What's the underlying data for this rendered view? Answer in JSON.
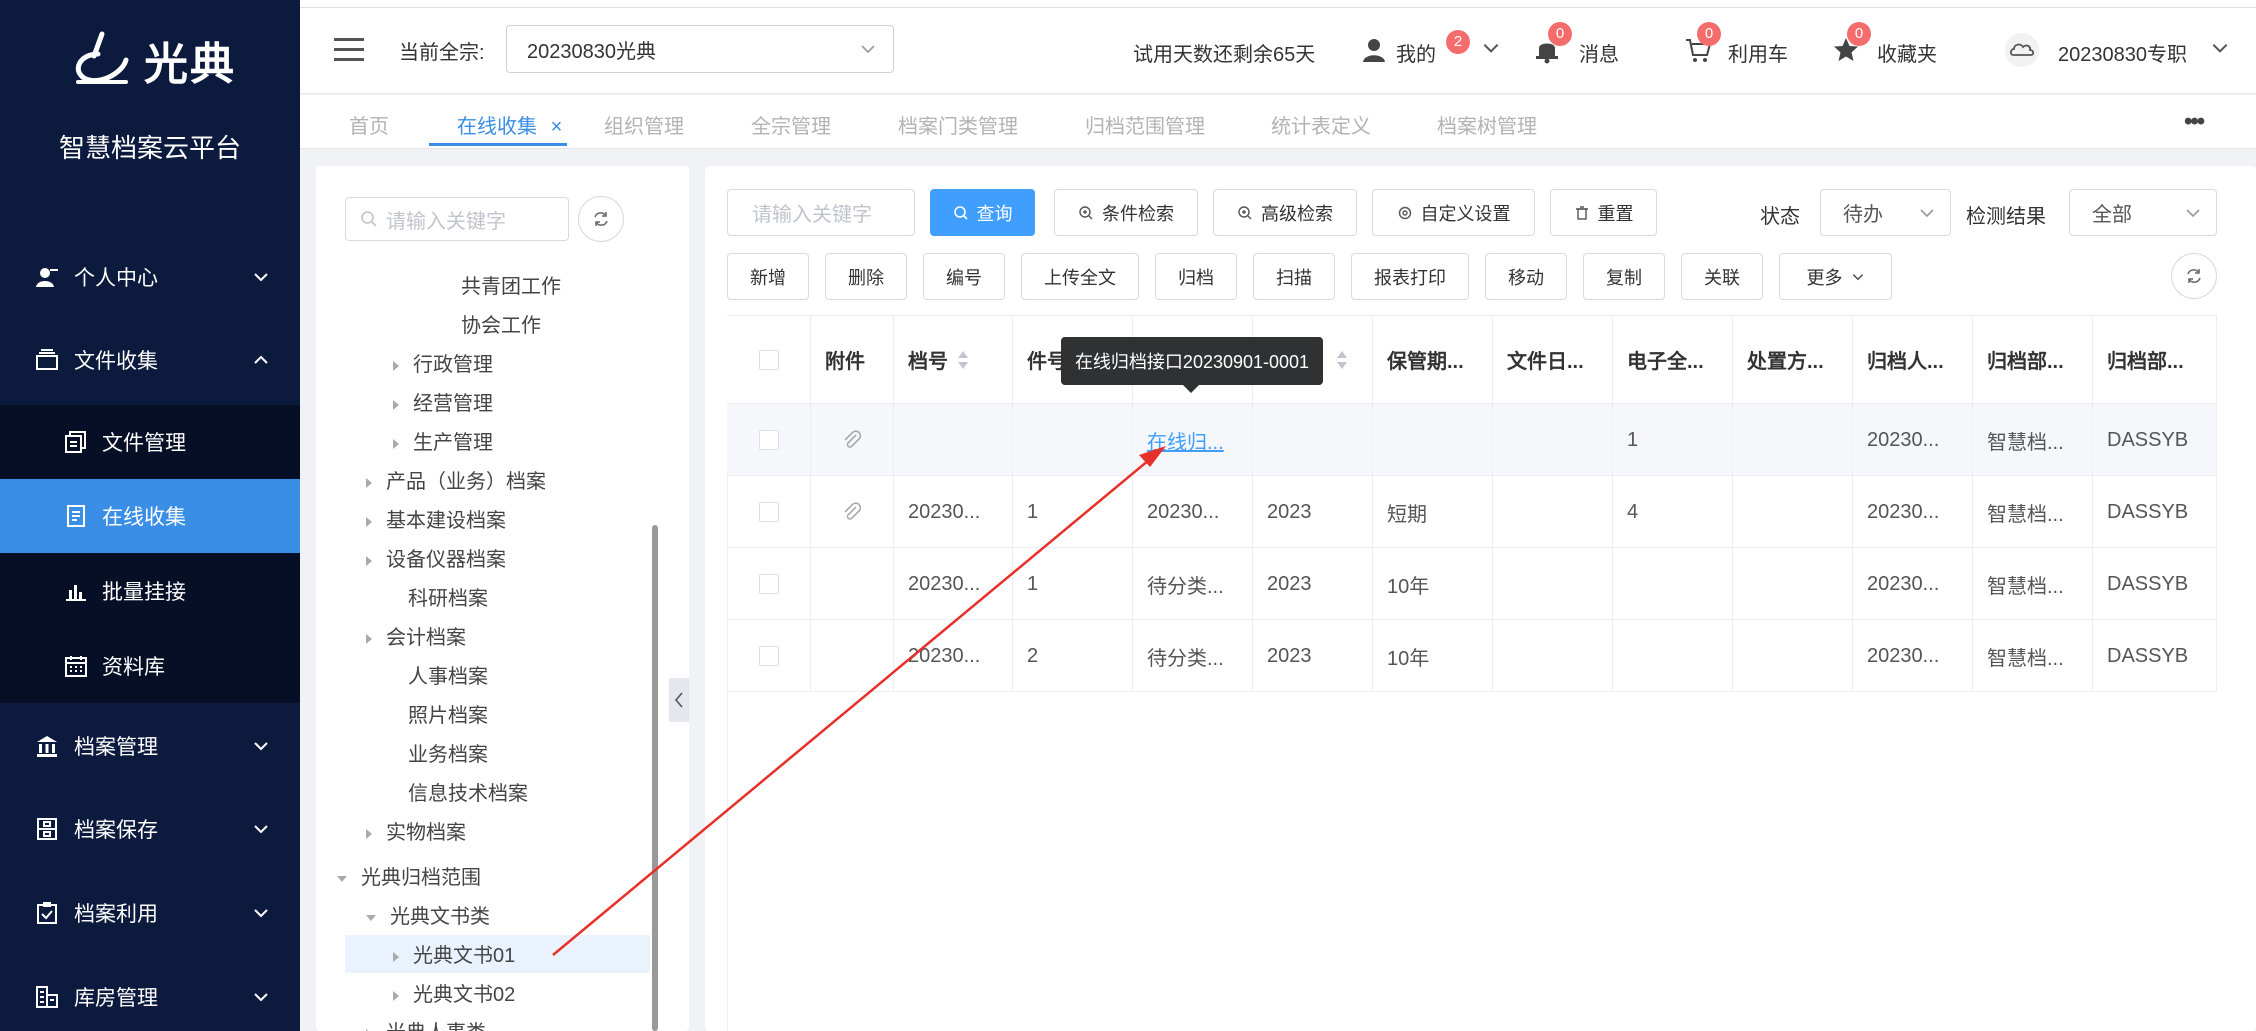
{
  "app": {
    "logo_text": "光典",
    "platform_name": "智慧档案云平台"
  },
  "sidebar": {
    "items": [
      {
        "label": "个人中心",
        "icon": "user-icon",
        "expanded": false
      },
      {
        "label": "文件收集",
        "icon": "folder-icon",
        "expanded": true
      },
      {
        "label": "档案管理",
        "icon": "bank-icon",
        "expanded": false
      },
      {
        "label": "档案保存",
        "icon": "archive-box-icon",
        "expanded": false
      },
      {
        "label": "档案利用",
        "icon": "clipboard-icon",
        "expanded": false
      },
      {
        "label": "库房管理",
        "icon": "warehouse-icon",
        "expanded": false
      }
    ],
    "subitems": [
      {
        "label": "文件管理",
        "icon": "file-manage-icon"
      },
      {
        "label": "在线收集",
        "icon": "doc-icon",
        "active": true
      },
      {
        "label": "批量挂接",
        "icon": "bar-chart-icon"
      },
      {
        "label": "资料库",
        "icon": "calendar-icon"
      }
    ]
  },
  "header": {
    "quanzong_label": "当前全宗:",
    "quanzong_value": "20230830光典",
    "trial_text": "试用天数还剩余65天",
    "my_label": "我的",
    "my_badge": "2",
    "msg_label": "消息",
    "msg_badge": "0",
    "cart_label": "利用车",
    "cart_badge": "0",
    "fav_label": "收藏夹",
    "fav_badge": "0",
    "account_label": "20230830专职"
  },
  "tabs": [
    {
      "label": "首页"
    },
    {
      "label": "在线收集",
      "active": true,
      "close": "×"
    },
    {
      "label": "组织管理"
    },
    {
      "label": "全宗管理"
    },
    {
      "label": "档案门类管理"
    },
    {
      "label": "归档范围管理"
    },
    {
      "label": "统计表定义"
    },
    {
      "label": "档案树管理"
    }
  ],
  "tree": {
    "search_placeholder": "请输入关键字",
    "nodes": [
      {
        "label": "共青团工作",
        "caret": ""
      },
      {
        "label": "协会工作",
        "caret": ""
      },
      {
        "label": "行政管理",
        "caret": "right"
      },
      {
        "label": "经营管理",
        "caret": "right"
      },
      {
        "label": "生产管理",
        "caret": "right"
      },
      {
        "label": "产品（业务）档案",
        "caret": "right"
      },
      {
        "label": "基本建设档案",
        "caret": "right"
      },
      {
        "label": "设备仪器档案",
        "caret": "right"
      },
      {
        "label": "科研档案",
        "caret": ""
      },
      {
        "label": "会计档案",
        "caret": "right"
      },
      {
        "label": "人事档案",
        "caret": ""
      },
      {
        "label": "照片档案",
        "caret": ""
      },
      {
        "label": "业务档案",
        "caret": ""
      },
      {
        "label": "信息技术档案",
        "caret": ""
      },
      {
        "label": "实物档案",
        "caret": "right"
      },
      {
        "label": "光典归档范围",
        "caret": "down"
      },
      {
        "label": "光典文书类",
        "caret": "down"
      },
      {
        "label": "光典文书01",
        "caret": "right",
        "selected": true
      },
      {
        "label": "光典文书02",
        "caret": "right"
      },
      {
        "label": "光典人事类",
        "caret": "right"
      }
    ]
  },
  "toolbar": {
    "keyword_placeholder": "请输入关键字",
    "query": "查询",
    "cond_search": "条件检索",
    "adv_search": "高级检索",
    "custom_settings": "自定义设置",
    "reset": "重置",
    "status_label": "状态",
    "status_value": "待办",
    "check_label": "检测结果",
    "check_value": "全部",
    "actions": [
      "新增",
      "删除",
      "编号",
      "上传全文",
      "归档",
      "扫描",
      "报表打印",
      "移动",
      "复制",
      "关联"
    ],
    "more": "更多"
  },
  "table": {
    "columns": [
      "附件",
      "档号",
      "件号",
      "",
      "",
      "保管期...",
      "文件日...",
      "电子全...",
      "处置方...",
      "归档人...",
      "归档部...",
      "归档部..."
    ],
    "rows": [
      {
        "attach": true,
        "dh": "",
        "jh": "",
        "title": "在线归...",
        "year": "",
        "bgqx": "",
        "wjrq": "",
        "dzqw": "1",
        "czfs": "",
        "gdr": "20230...",
        "gdbm": "智慧档...",
        "gdbm2": "DASSYB",
        "hover": true
      },
      {
        "attach": true,
        "dh": "20230...",
        "jh": "1",
        "title": "20230...",
        "year": "2023",
        "bgqx": "短期",
        "wjrq": "",
        "dzqw": "4",
        "czfs": "",
        "gdr": "20230...",
        "gdbm": "智慧档...",
        "gdbm2": "DASSYB"
      },
      {
        "attach": false,
        "dh": "20230...",
        "jh": "1",
        "title": "待分类...",
        "year": "2023",
        "bgqx": "10年",
        "wjrq": "",
        "dzqw": "",
        "czfs": "",
        "gdr": "20230...",
        "gdbm": "智慧档...",
        "gdbm2": "DASSYB"
      },
      {
        "attach": false,
        "dh": "20230...",
        "jh": "2",
        "title": "待分类...",
        "year": "2023",
        "bgqx": "10年",
        "wjrq": "",
        "dzqw": "",
        "czfs": "",
        "gdr": "20230...",
        "gdbm": "智慧档...",
        "gdbm2": "DASSYB"
      }
    ]
  },
  "tooltip": {
    "text": "在线归档接口20230901-0001"
  },
  "colors": {
    "sidebar_bg": "#0b1a3d",
    "accent": "#409eff",
    "badge": "#f56c6c",
    "annotation_arrow": "#e8302a"
  }
}
